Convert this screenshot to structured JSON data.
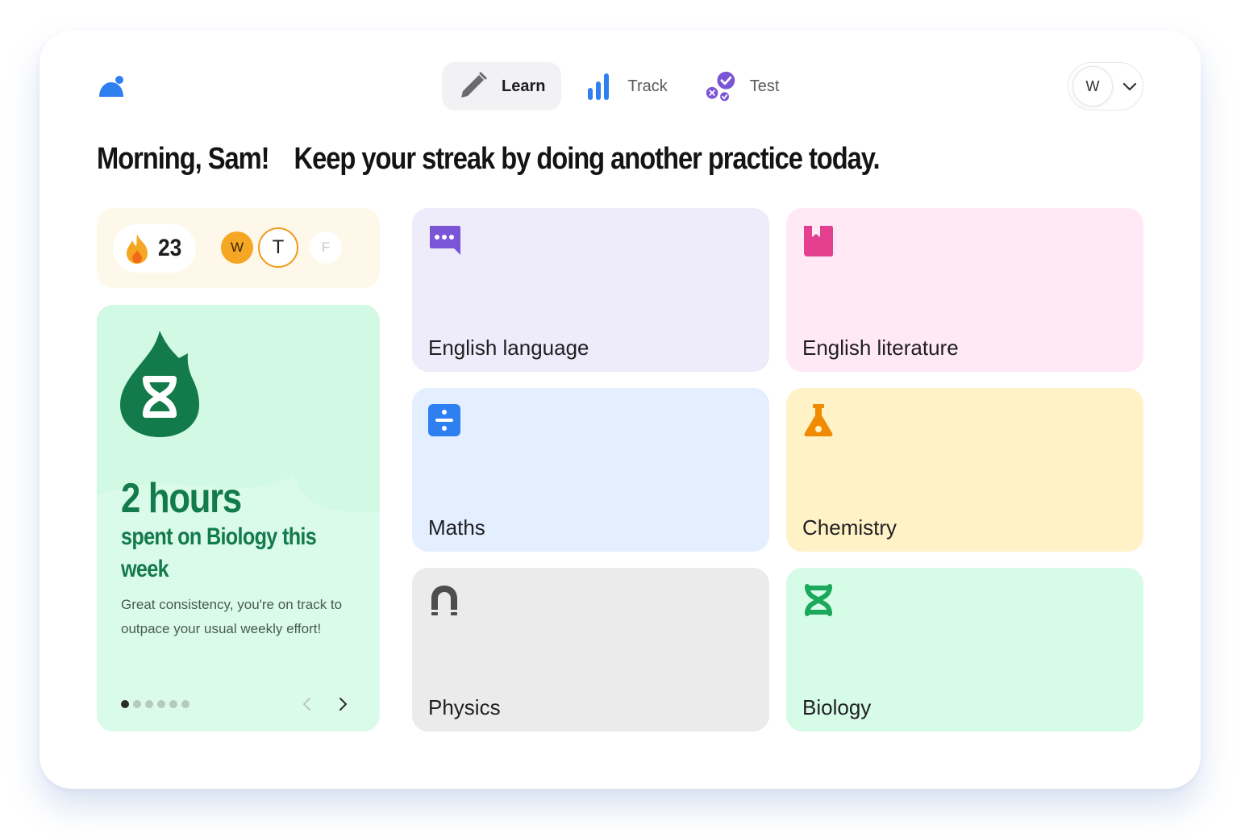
{
  "nav": {
    "items": [
      {
        "label": "Learn",
        "icon": "pencil-icon",
        "active": true
      },
      {
        "label": "Track",
        "icon": "bar-chart-icon",
        "active": false
      },
      {
        "label": "Test",
        "icon": "check-badges-icon",
        "active": false
      }
    ]
  },
  "account": {
    "initial": "W",
    "menu_icon": "chevron-down-icon"
  },
  "heading": {
    "greeting": "Morning, Sam!",
    "message": "Keep your streak by doing another practice today."
  },
  "streak": {
    "count": "23",
    "icon": "flame-icon",
    "days": [
      {
        "label": "W",
        "state": "done"
      },
      {
        "label": "T",
        "state": "today"
      },
      {
        "label": "F",
        "state": "future"
      }
    ]
  },
  "insight": {
    "icon": "biology-drop-icon",
    "title": "2 hours",
    "subtitle": "spent on Biology this week",
    "body": "Great consistency, you're on track to outpace your usual weekly effort!",
    "pages_total": 6,
    "page_current": 1
  },
  "subjects": [
    {
      "label": "English language",
      "icon": "speech-bubble-icon",
      "bg": "#eeebfa",
      "accent": "#7a55d6"
    },
    {
      "label": "English literature",
      "icon": "book-icon",
      "bg": "#ffe9f4",
      "accent": "#e5408f"
    },
    {
      "label": "Maths",
      "icon": "divide-icon",
      "bg": "#e3efff",
      "accent": "#2e7ff0"
    },
    {
      "label": "Chemistry",
      "icon": "flask-icon",
      "bg": "#fff2c6",
      "accent": "#f08a00"
    },
    {
      "label": "Physics",
      "icon": "magnet-icon",
      "bg": "#ebebeb",
      "accent": "#4d4d50"
    },
    {
      "label": "Biology",
      "icon": "dna-icon",
      "bg": "#d6fbe6",
      "accent": "#1aa85a"
    }
  ],
  "colors": {
    "brand": "#2e7ff0",
    "streak_bg": "#fef8eb",
    "insight_bg": "#dafbe9",
    "insight_text": "#137a4c"
  }
}
